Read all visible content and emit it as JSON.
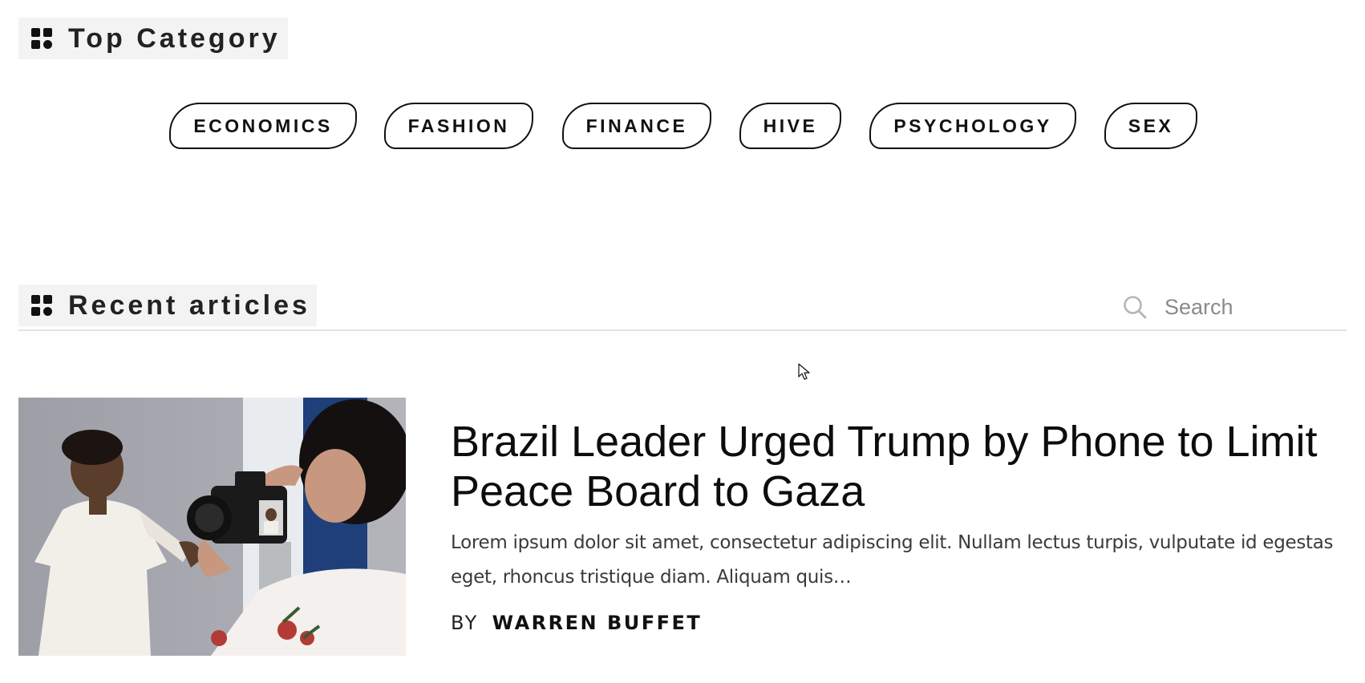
{
  "top_category": {
    "heading": "Top Category",
    "categories": [
      "ECONOMICS",
      "FASHION",
      "FINANCE",
      "HIVE",
      "PSYCHOLOGY",
      "SEX"
    ]
  },
  "recent_articles": {
    "heading": "Recent articles",
    "search": {
      "placeholder": "Search",
      "value": ""
    }
  },
  "article": {
    "title": "Brazil Leader Urged Trump by Phone to Limit Peace Board to Gaza",
    "excerpt": "Lorem ipsum dolor sit amet, consectetur adipiscing elit. Nullam lectus turpis, vulputate id egestas eget, rhoncus tristique diam. Aliquam quis…",
    "by_label": "BY",
    "author": "WARREN BUFFET",
    "image_icon": "photographer-photo"
  },
  "icons": {
    "section": "grid-icon",
    "search": "search-icon",
    "cursor": "mouse-pointer-icon"
  }
}
